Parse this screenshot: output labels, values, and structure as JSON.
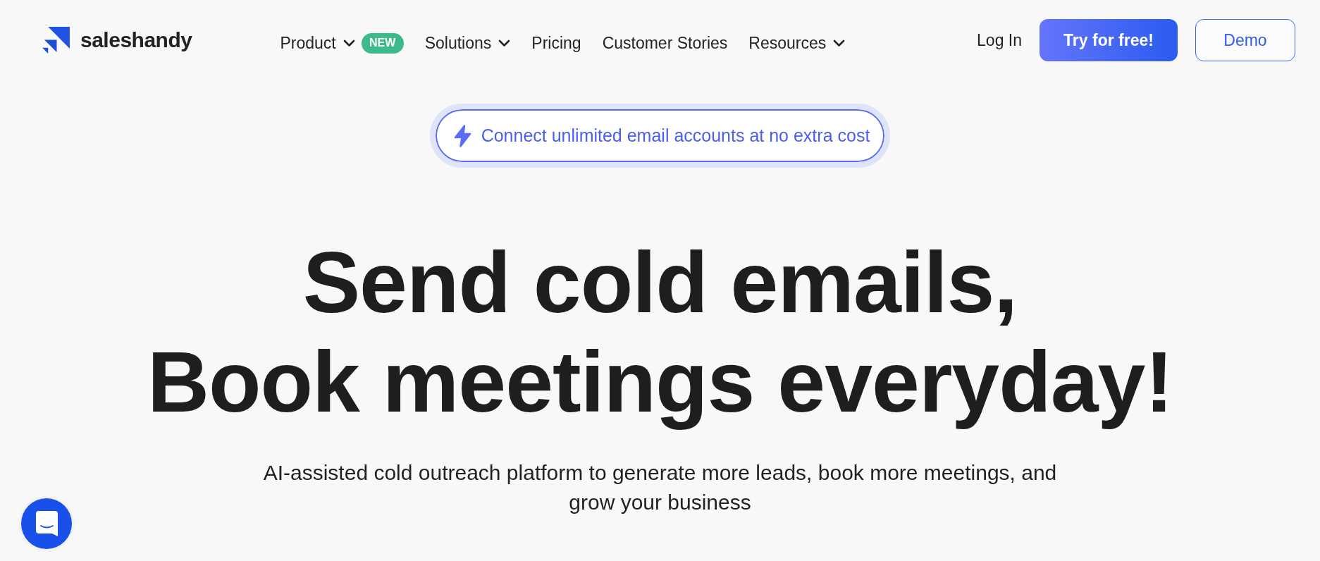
{
  "header": {
    "logo": "saleshandy",
    "nav": [
      {
        "label": "Product",
        "dropdown": true,
        "badge": "NEW"
      },
      {
        "label": "Solutions",
        "dropdown": true
      },
      {
        "label": "Pricing",
        "dropdown": false
      },
      {
        "label": "Customer Stories",
        "dropdown": false
      },
      {
        "label": "Resources",
        "dropdown": true
      }
    ],
    "actions": [
      {
        "label": "Log In",
        "kind": "link"
      },
      {
        "label": "Try for free!",
        "kind": "primary"
      },
      {
        "label": "Demo",
        "kind": "outline"
      }
    ]
  },
  "announcement": {
    "text": "Connect unlimited email accounts at no extra cost"
  },
  "hero": {
    "headline": [
      "Send cold emails,",
      "Book meetings everyday!"
    ],
    "subtitle": "AI-assisted cold outreach platform to generate more leads, book more meetings, and grow your business"
  }
}
